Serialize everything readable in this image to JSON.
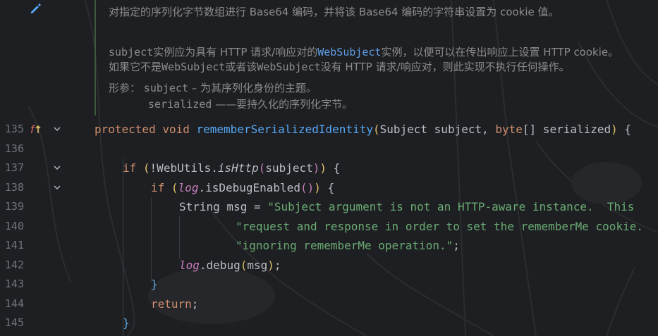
{
  "colors": {
    "background": "#1e1f22",
    "keyword": "#cf8e6d",
    "function": "#56a8f5",
    "string": "#6aab73",
    "field": "#c77dbb",
    "comment": "#8c8c8c",
    "line_number": "#6f737a"
  },
  "doc": {
    "line1": "对指定的序列化字节数组进行 Base64 编码，并将该 Base64 编码的字符串设置为 cookie 值。",
    "para2": {
      "p1": "subject",
      "p2": "实例应为具有 HTTP 请求/响应对的",
      "p3": "WebSubject",
      "p4": "实例，以便可以在传出响应上设置 HTTP cookie。",
      "p5": "如果它不是",
      "p6": "WebSubject",
      "p7": "或者该",
      "p8": "WebSubject",
      "p9": "没有 HTTP 请求/响应对，则此实现不执行任何操作。"
    },
    "params_label": "形参：",
    "param1_name": "subject",
    "param1_desc": " – 为其序列化身份的主题。",
    "param2_name": "serialized",
    "param2_desc": " ——要持久化的序列化字节。"
  },
  "gutter": {
    "edit_icon": "pencil-icon",
    "override_icon": "implements-method-icon",
    "fold_icon": "chevron-down-icon"
  },
  "line_numbers": [
    "135",
    "136",
    "137",
    "138",
    "139",
    "140",
    "141",
    "142",
    "143",
    "144",
    "145"
  ],
  "code": {
    "l135": {
      "kw1": "protected",
      "kw2": "void",
      "fn": "rememberSerializedIdentity",
      "p_open": "(",
      "t1": "Subject subject, ",
      "kw3": "byte",
      "t2": "[] serialized",
      "p_close": ")",
      "t3": " {"
    },
    "l137": {
      "kw": "if",
      "sp": " ",
      "p1": "(",
      "t1": "!WebUtils.",
      "fn": "isHttp",
      "p2": "(",
      "t2": "subject",
      "p3": ")",
      "p4": ")",
      "t3": " {"
    },
    "l138": {
      "kw": "if",
      "sp": " ",
      "p1": "(",
      "field": "log",
      "t1": ".isDebugEnabled",
      "p2": "()",
      "p3": ")",
      "t2": " {"
    },
    "l139": {
      "t1": "String msg = ",
      "str": "\"Subject argument is not an HTTP-aware instance.  This"
    },
    "l140": {
      "str": "\"request and response in order to set the rememberMe cookie."
    },
    "l141": {
      "str": "\"ignoring rememberMe operation.\"",
      "t1": ";"
    },
    "l142": {
      "field": "log",
      "t1": ".debug",
      "p1": "(",
      "t2": "msg",
      "p2": ")",
      "t3": ";"
    },
    "l143": {
      "t1": "}"
    },
    "l144": {
      "kw": "return",
      "t1": ";"
    },
    "l145": {
      "t1": "}"
    }
  }
}
